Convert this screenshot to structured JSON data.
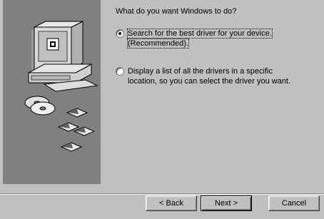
{
  "wizard": {
    "question": "What do you want Windows to do?",
    "option1_line1": "Search for the best driver for your device.",
    "option1_line2": "(Recommended).",
    "option2_line1": "Display a list of all the drivers in a specific",
    "option2_line2": "location, so you can select the driver you want.",
    "selected_option": "search"
  },
  "buttons": {
    "back": "< Back",
    "next": "Next >",
    "cancel": "Cancel"
  },
  "colors": {
    "dialog_bg": "#c0c0c0",
    "side_panel": "#808080"
  },
  "icons": [
    "computer-icon",
    "cd-disc-icon",
    "floppy-disk-icon"
  ]
}
